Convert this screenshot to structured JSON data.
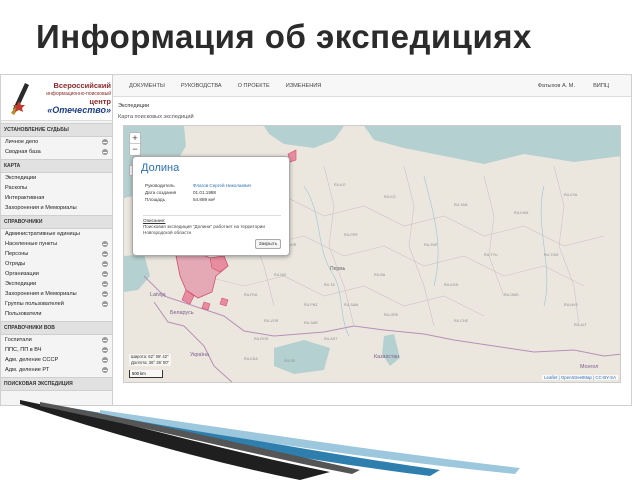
{
  "slide": {
    "title": "Информация об экспедициях"
  },
  "logo": {
    "line1": "Всероссийский",
    "line2": "информационно-поисковый",
    "line3": "центр",
    "line4": "«Отечество»"
  },
  "sidebar": {
    "sections": [
      {
        "title": "УСТАНОВЛЕНИЕ СУДЬБЫ",
        "items": [
          {
            "label": "Личное дело",
            "expand": true
          },
          {
            "label": "Сводная база",
            "expand": true
          }
        ]
      },
      {
        "title": "КАРТА",
        "items": [
          {
            "label": "Экспедиции",
            "expand": false
          },
          {
            "label": "Раскопы",
            "expand": false
          },
          {
            "label": "Интерактивная",
            "expand": false
          },
          {
            "label": "Захоронения и Мемориалы",
            "expand": false
          }
        ]
      },
      {
        "title": "СПРАВОЧНИКИ",
        "items": [
          {
            "label": "Административные единицы",
            "expand": false
          },
          {
            "label": "Населенные пункты",
            "expand": true
          },
          {
            "label": "Персоны",
            "expand": true
          },
          {
            "label": "Отряды",
            "expand": true
          },
          {
            "label": "Организации",
            "expand": true
          },
          {
            "label": "Экспедиции",
            "expand": true
          },
          {
            "label": "Захоронения и Мемориалы",
            "expand": true
          },
          {
            "label": "Группы пользователей",
            "expand": true
          },
          {
            "label": "Пользователи",
            "expand": false
          }
        ]
      },
      {
        "title": "СПРАВОЧНИКИ ВОВ",
        "items": [
          {
            "label": "Госпитали",
            "expand": true
          },
          {
            "label": "ППС, ПП в ВЧ",
            "expand": true
          },
          {
            "label": "Адм. деление СССР",
            "expand": true
          },
          {
            "label": "Адм. деление РТ",
            "expand": true
          }
        ]
      },
      {
        "title": "ПОИСКОВАЯ ЭКСПЕДИЦИЯ",
        "items": []
      }
    ]
  },
  "topnav": {
    "items": [
      "ДОКУМЕНТЫ",
      "РУКОВОДСТВА",
      "О ПРОЕКТЕ",
      "ИЗМЕНЕНИЯ"
    ],
    "user": "Фатыхов А. М.",
    "org": "ВИПЦ"
  },
  "breadcrumb": {
    "title": "Экспедиции",
    "subtitle": "Карта поисковых экспедиций"
  },
  "map": {
    "zoom_in": "+",
    "zoom_out": "−",
    "layers": "→",
    "popup": {
      "title": "Долина",
      "fields": [
        {
          "label": "Руководитель",
          "value": "Флагов Сергей Николаевич",
          "link": true
        },
        {
          "label": "Дата создания",
          "value": "01.01.1988",
          "link": false
        },
        {
          "label": "Площадь",
          "value": "54.889 км²",
          "link": false
        }
      ],
      "desc_label": "Описание:",
      "desc_text": "Поисковая экспедиция \"Долина\" работает на территории Новгородской области",
      "close": "Закрыть"
    },
    "labels": {
      "perm": "Пермь",
      "belarus": "Беларусь",
      "ukraina": "Україна",
      "kazakhstan": "Казахстан",
      "mongol": "Монгол",
      "latvija": "Latvija"
    },
    "coords_lat": "Широта: 62° 08' 42\"",
    "coords_lon": "Долгота: 36° 36' 00\"",
    "scale": "500 km",
    "attribution": "Leaflet | OpenStreetMap | CC-BY-SA"
  }
}
